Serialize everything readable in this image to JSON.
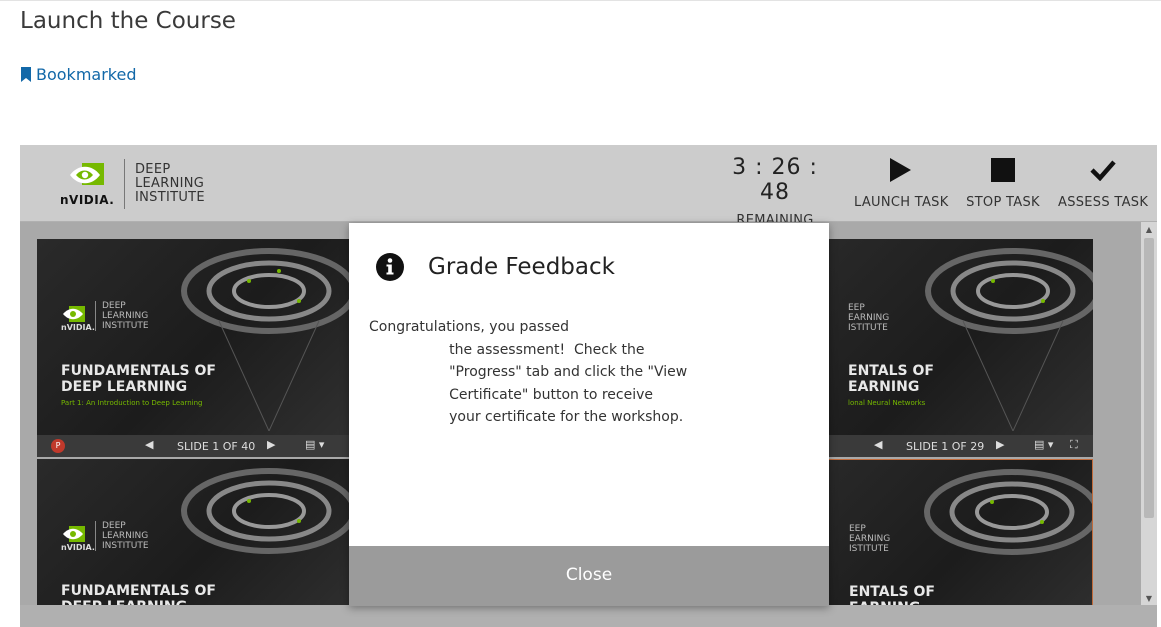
{
  "page": {
    "title": "Launch the Course",
    "bookmark_label": "Bookmarked"
  },
  "header": {
    "brand_word": "nVIDIA.",
    "dli_line1": "DEEP",
    "dli_line2": "LEARNING",
    "dli_line3": "INSTITUTE",
    "timer_value": "3 : 26 : 48",
    "timer_label": "REMAINING TIME",
    "launch_label": "LAUNCH TASK",
    "stop_label": "STOP TASK",
    "assess_label": "ASSESS TASK"
  },
  "slides": [
    {
      "title_line1": "FUNDAMENTALS OF",
      "title_line2": "DEEP LEARNING",
      "subtitle": "Part 1: An Introduction to Deep Learning",
      "counter": "SLIDE 1 OF 40"
    },
    {
      "title_line1": "ENTALS OF",
      "title_line2": "EARNING",
      "subtitle": "lonal Neural Networks",
      "counter": "SLIDE 1 OF 29"
    },
    {
      "title_line1": "FUNDAMENTALS OF",
      "title_line2": "DEEP LEARNING"
    },
    {
      "title_line1": "ENTALS OF",
      "title_line2": "EARNING"
    }
  ],
  "slide_logo": {
    "word": "nVIDIA.",
    "dli_line1": "DEEP",
    "dli_line2": "LEARNING",
    "dli_line3": "INSTITUTE",
    "partial_line1": "EEP",
    "partial_line2": "EARNING",
    "partial_line3": "ISTITUTE"
  },
  "dialog": {
    "title": "Grade Feedback",
    "body_lines": [
      "Congratulations, you passed",
      "                  the assessment!  Check the",
      "                  \"Progress\" tab and click the \"View",
      "                  Certificate\" button to receive",
      "                  your certificate for the workshop."
    ],
    "close_label": "Close"
  },
  "colors": {
    "link": "#1268a8",
    "nvidia_green": "#76b900",
    "header_bg": "#cccccc",
    "dialog_footer": "#9b9b9b"
  }
}
